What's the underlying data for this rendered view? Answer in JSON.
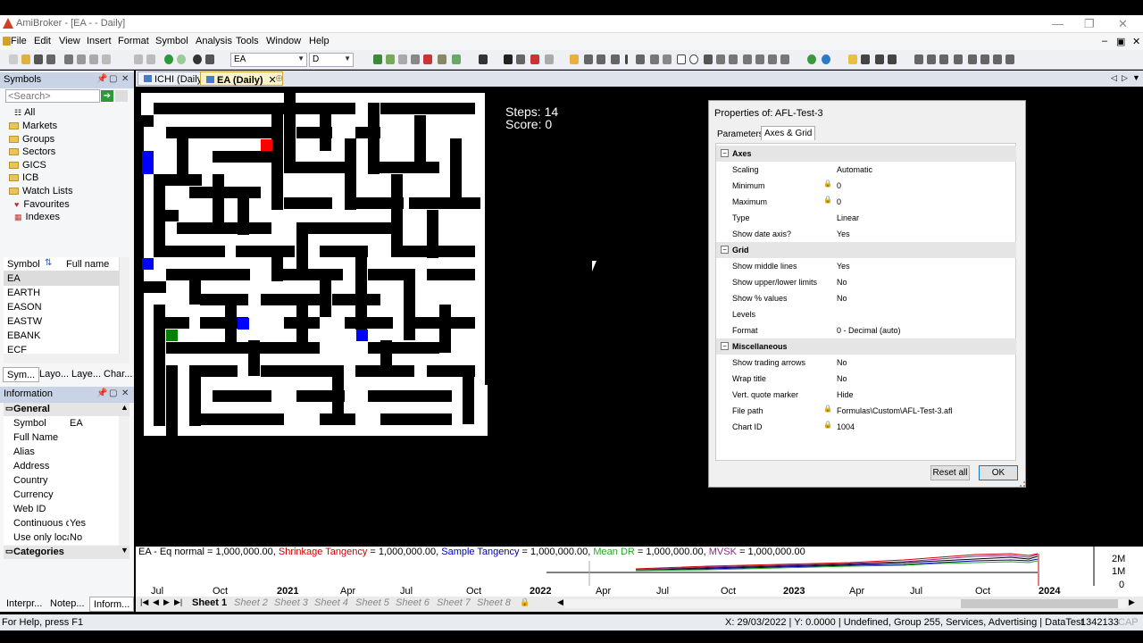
{
  "window": {
    "title": "AmiBroker - [EA - - Daily]"
  },
  "menu": [
    "File",
    "Edit",
    "View",
    "Insert",
    "Format",
    "Symbol",
    "Analysis",
    "Tools",
    "Window",
    "Help"
  ],
  "toolbar": {
    "symbol_value": "EA",
    "interval_value": "D"
  },
  "chart_tabs": [
    {
      "label": "ICHI (Daily)",
      "active": false
    },
    {
      "label": "EA (Daily)",
      "active": true
    }
  ],
  "symbols_panel": {
    "title": "Symbols",
    "search_placeholder": "<Search>",
    "tree": [
      "All",
      "Markets",
      "Groups",
      "Sectors",
      "GICS",
      "ICB",
      "Watch Lists",
      "Favourites",
      "Indexes"
    ],
    "col_symbol": "Symbol",
    "col_fullname": "Full name",
    "rows": [
      "EA",
      "EARTH",
      "EASON",
      "EASTW",
      "EBANK",
      "ECF"
    ],
    "tabs": [
      "Sym...",
      "Layo...",
      "Laye...",
      "Char..."
    ]
  },
  "info_panel": {
    "title": "Information",
    "section": "General",
    "fields": [
      {
        "k": "Symbol",
        "v": "EA"
      },
      {
        "k": "Full Name",
        "v": ""
      },
      {
        "k": "Alias",
        "v": ""
      },
      {
        "k": "Address",
        "v": ""
      },
      {
        "k": "Country",
        "v": ""
      },
      {
        "k": "Currency",
        "v": ""
      },
      {
        "k": "Web ID",
        "v": ""
      },
      {
        "k": "Continuous qu",
        "v": "Yes"
      },
      {
        "k": "Use only local",
        "v": "No"
      }
    ],
    "section2": "Categories",
    "tabs": [
      "Interpr...",
      "Notep...",
      "Inform..."
    ]
  },
  "game": {
    "steps_label": "Steps: 14",
    "score_label": "Score: 0"
  },
  "dialog": {
    "title": "Properties of: AFL-Test-3",
    "tab_parameters": "Parameters",
    "tab_axes": "Axes & Grid",
    "sections": [
      {
        "name": "Axes",
        "rows": [
          {
            "k": "Scaling",
            "v": "Automatic",
            "lock": false
          },
          {
            "k": "Minimum",
            "v": "0",
            "lock": true
          },
          {
            "k": "Maximum",
            "v": "0",
            "lock": true
          },
          {
            "k": "Type",
            "v": "Linear",
            "lock": false
          },
          {
            "k": "Show date axis?",
            "v": "Yes",
            "lock": false
          }
        ]
      },
      {
        "name": "Grid",
        "rows": [
          {
            "k": "Show middle lines",
            "v": "Yes",
            "lock": false
          },
          {
            "k": "Show upper/lower limits",
            "v": "No",
            "lock": false
          },
          {
            "k": "Show % values",
            "v": "No",
            "lock": false
          },
          {
            "k": "Levels",
            "v": "",
            "lock": false
          },
          {
            "k": "Format",
            "v": "0 - Decimal (auto)",
            "lock": false
          }
        ]
      },
      {
        "name": "Miscellaneous",
        "rows": [
          {
            "k": "Show trading arrows",
            "v": "No",
            "lock": false
          },
          {
            "k": "Wrap title",
            "v": "No",
            "lock": false
          },
          {
            "k": "Vert. quote marker",
            "v": "Hide",
            "lock": false
          },
          {
            "k": "File path",
            "v": "Formulas\\Custom\\AFL-Test-3.afl",
            "lock": true
          },
          {
            "k": "Chart ID",
            "v": "1004",
            "lock": true
          }
        ]
      }
    ],
    "reset_label": "Reset all",
    "ok_label": "OK"
  },
  "equity_pane": {
    "title_parts": [
      {
        "text": "EA - Eq normal = 1,000,000.00, ",
        "color": "#000000"
      },
      {
        "text": "Shrinkage Tangency",
        "color": "#cc0000"
      },
      {
        "text": " = 1,000,000.00, ",
        "color": "#000000"
      },
      {
        "text": "Sample Tangency",
        "color": "#0000aa"
      },
      {
        "text": " = 1,000,000.00, ",
        "color": "#000000"
      },
      {
        "text": "Mean DR",
        "color": "#22aa22"
      },
      {
        "text": " = 1,000,000.00, ",
        "color": "#000000"
      },
      {
        "text": "MVSK",
        "color": "#8a2a8a"
      },
      {
        "text": " = 1,000,000.00",
        "color": "#000000"
      }
    ],
    "y_labels": [
      "2M",
      "1M",
      "0"
    ],
    "x_labels": [
      "Jul",
      "Oct",
      "2021",
      "Apr",
      "Jul",
      "Oct",
      "2022",
      "Apr",
      "Jul",
      "Oct",
      "2023",
      "Apr",
      "Jul",
      "Oct",
      "2024"
    ]
  },
  "sheets": [
    "Sheet 1",
    "Sheet 2",
    "Sheet 3",
    "Sheet 4",
    "Sheet 5",
    "Sheet 6",
    "Sheet 7",
    "Sheet 8"
  ],
  "status": {
    "left": "For Help, press F1",
    "coords": "X: 29/03/2022 | Y: 0.0000 | Undefined, Group 255, Services, Advertising | DataTest",
    "right": "1342133",
    "cap": "CAP"
  }
}
